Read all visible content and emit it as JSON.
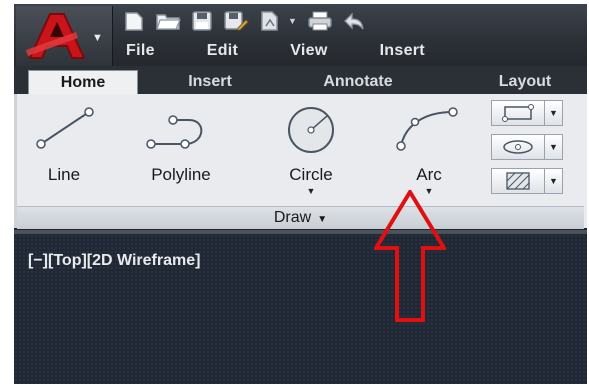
{
  "quick_access": {
    "icons": [
      "new-icon",
      "open-icon",
      "save-icon",
      "save-as-icon",
      "plot-icon",
      "print-icon",
      "undo-icon"
    ]
  },
  "menu": [
    "File",
    "Edit",
    "View",
    "Insert"
  ],
  "ribbon_tabs": [
    {
      "label": "Home",
      "active": true
    },
    {
      "label": "Insert",
      "active": false
    },
    {
      "label": "Annotate",
      "active": false
    },
    {
      "label": "Layout",
      "active": false
    }
  ],
  "draw_panel": {
    "title": "Draw",
    "tools": [
      {
        "label": "Line",
        "has_dropdown": false
      },
      {
        "label": "Polyline",
        "has_dropdown": false
      },
      {
        "label": "Circle",
        "has_dropdown": true
      },
      {
        "label": "Arc",
        "has_dropdown": true
      }
    ],
    "small_tools": [
      "rectangle-icon",
      "ellipse-icon",
      "hatch-icon"
    ]
  },
  "viewport": {
    "label": "[−][Top][2D Wireframe]"
  },
  "colors": {
    "annotation_arrow": "#e01010",
    "logo_red": "#c8141a",
    "dark_ui": "#2b3037"
  }
}
